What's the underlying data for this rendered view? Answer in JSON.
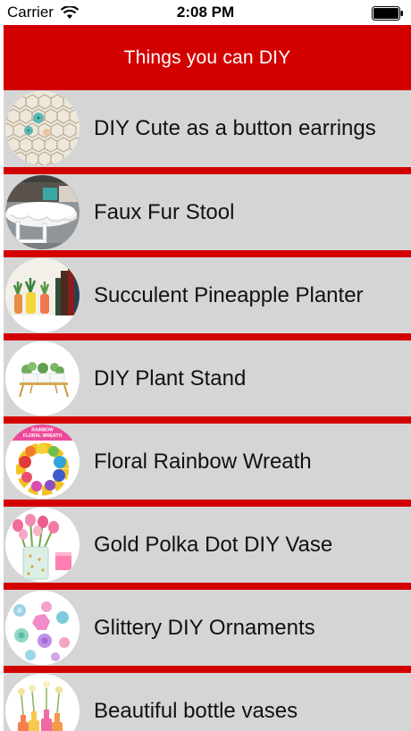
{
  "status_bar": {
    "carrier": "Carrier",
    "time": "2:08 PM"
  },
  "nav": {
    "title": "Things you can DIY"
  },
  "colors": {
    "accent": "#d30000",
    "row_bg": "#d5d5d5"
  },
  "items": [
    {
      "label": "DIY Cute as a button earrings",
      "thumb": "earrings-icon"
    },
    {
      "label": "Faux Fur Stool",
      "thumb": "stool-icon"
    },
    {
      "label": "Succulent Pineapple Planter",
      "thumb": "planter-icon"
    },
    {
      "label": "DIY Plant Stand",
      "thumb": "plant-stand-icon"
    },
    {
      "label": "Floral Rainbow Wreath",
      "thumb": "wreath-icon",
      "thumb_text": [
        "RAINBOW",
        "FLORAL WREATH"
      ]
    },
    {
      "label": "Gold Polka Dot DIY Vase",
      "thumb": "vase-icon"
    },
    {
      "label": "Glittery DIY Ornaments",
      "thumb": "ornaments-icon"
    },
    {
      "label": "Beautiful bottle vases",
      "thumb": "bottle-vases-icon"
    }
  ]
}
